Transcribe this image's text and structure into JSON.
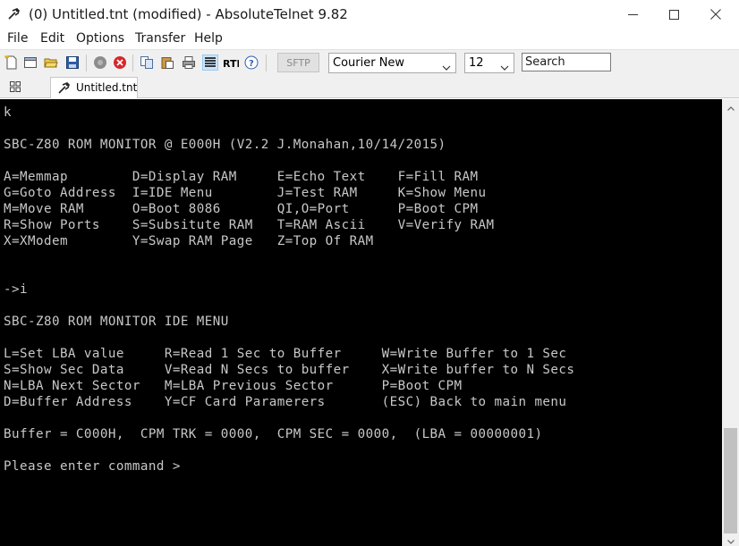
{
  "window": {
    "title": "(0) Untitled.tnt (modified) - AbsoluteTelnet 9.82"
  },
  "menu": [
    "File",
    "Edit",
    "Options",
    "Transfer",
    "Help"
  ],
  "toolbar": {
    "sftp_label": "SFTP",
    "font_value": "Courier New",
    "size_value": "12",
    "search_value": "Search"
  },
  "tabs": [
    {
      "label": "Untitled.tnt"
    }
  ],
  "terminal": {
    "lines": [
      "k",
      "",
      "SBC-Z80 ROM MONITOR @ E000H (V2.2 J.Monahan,10/14/2015)",
      "",
      "A=Memmap        D=Display RAM     E=Echo Text    F=Fill RAM",
      "G=Goto Address  I=IDE Menu        J=Test RAM     K=Show Menu",
      "M=Move RAM      O=Boot 8086       QI,O=Port      P=Boot CPM",
      "R=Show Ports    S=Subsitute RAM   T=RAM Ascii    V=Verify RAM",
      "X=XModem        Y=Swap RAM Page   Z=Top Of RAM",
      "",
      "",
      "->i",
      "",
      "SBC-Z80 ROM MONITOR IDE MENU",
      "",
      "L=Set LBA value     R=Read 1 Sec to Buffer     W=Write Buffer to 1 Sec",
      "S=Show Sec Data     V=Read N Secs to buffer    X=Write buffer to N Secs",
      "N=LBA Next Sector   M=LBA Previous Sector      P=Boot CPM",
      "D=Buffer Address    Y=CF Card Paramerers       (ESC) Back to main menu",
      "",
      "Buffer = C000H,  CPM TRK = 0000,  CPM SEC = 0000,  (LBA = 00000001)",
      "",
      "Please enter command >"
    ]
  },
  "colors": {
    "terminal_bg": "#000000",
    "terminal_fg": "#c8c8c8",
    "chrome_bg": "#f0f0f0"
  },
  "icons": {
    "title": "telnet-app-icon",
    "window_controls": [
      "minimize-icon",
      "maximize-icon",
      "close-icon"
    ],
    "toolbar": [
      "new-doc-icon",
      "new-window-icon",
      "open-folder-icon",
      "save-icon",
      "disconnect-icon",
      "stop-icon",
      "copy-icon",
      "paste-icon",
      "print-icon",
      "text-align-icon",
      "rtl-icon",
      "help-icon"
    ]
  }
}
